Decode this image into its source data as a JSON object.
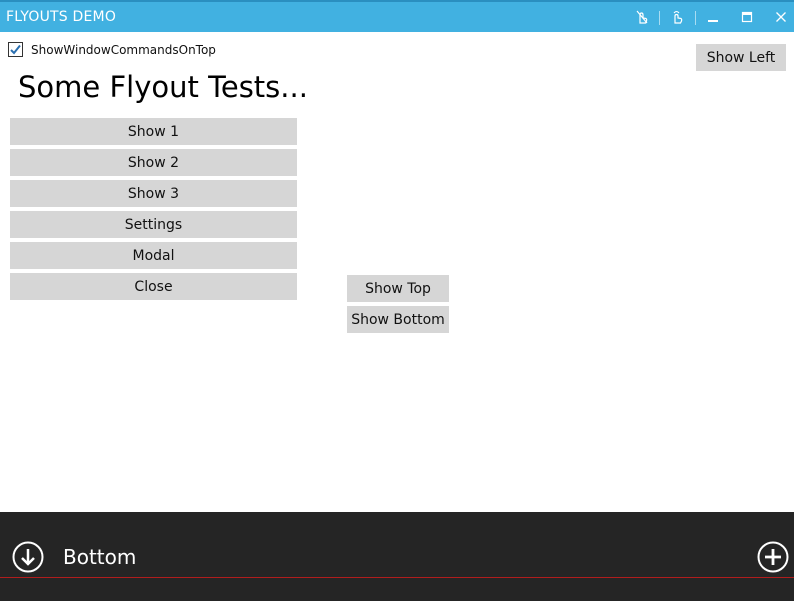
{
  "window": {
    "title": "FLYOUTS DEMO",
    "accent_color": "#41b1e1",
    "commands": [
      {
        "icon": "finger-gesture-icon"
      },
      {
        "icon": "hand-pointer-icon"
      },
      {
        "icon": "minimize-icon"
      },
      {
        "icon": "maximize-icon"
      },
      {
        "icon": "close-icon"
      }
    ]
  },
  "options": {
    "show_commands_label": "ShowWindowCommandsOnTop",
    "show_commands_checked": true
  },
  "main": {
    "heading": "Some Flyout Tests...",
    "buttons": [
      "Show 1",
      "Show 2",
      "Show 3",
      "Settings",
      "Modal",
      "Close"
    ],
    "show_top_label": "Show Top",
    "show_bottom_label": "Show Bottom",
    "show_left_label": "Show Left"
  },
  "bottom_flyout": {
    "title": "Bottom",
    "background": "#252525",
    "back_icon": "arrow-down-circle-icon",
    "action_icon": "plus-circle-icon"
  }
}
